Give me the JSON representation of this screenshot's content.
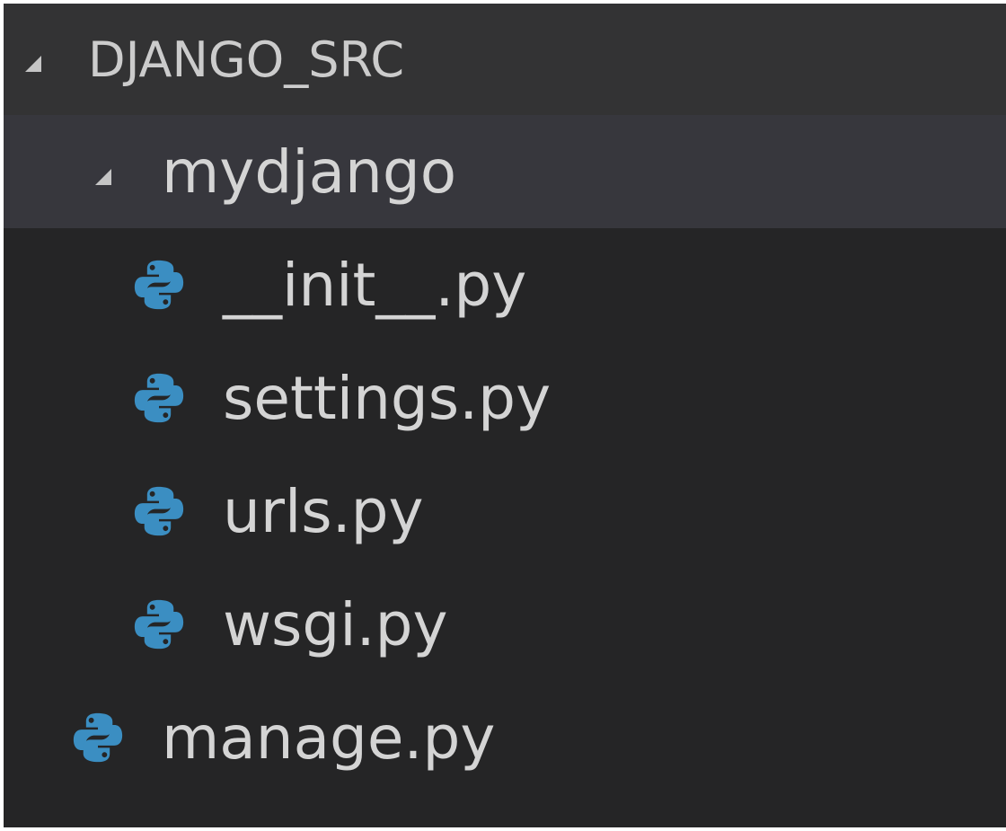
{
  "explorer": {
    "section_title": "DJANGO_SRC",
    "folder": {
      "label": "mydjango",
      "expanded": true
    },
    "folder_files": [
      {
        "label": "__init__.py",
        "icon": "python-icon"
      },
      {
        "label": "settings.py",
        "icon": "python-icon"
      },
      {
        "label": "urls.py",
        "icon": "python-icon"
      },
      {
        "label": "wsgi.py",
        "icon": "python-icon"
      }
    ],
    "root_files": [
      {
        "label": "manage.py",
        "icon": "python-icon"
      }
    ],
    "colors": {
      "background": "#252526",
      "header_bg": "#333334",
      "selected_row_bg": "#37373d",
      "python_icon": "#3c8dbc"
    }
  }
}
